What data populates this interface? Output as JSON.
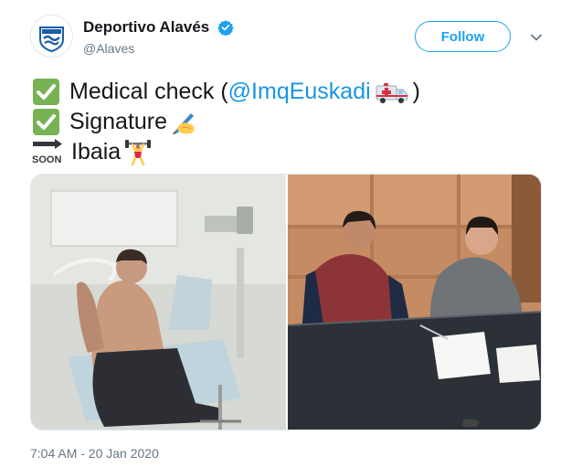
{
  "account": {
    "display_name": "Deportivo Alavés",
    "handle": "@Alaves",
    "avatar_icon": "deportivo-alaves-crest-icon",
    "verified_icon": "verified-badge-icon"
  },
  "actions": {
    "follow_label": "Follow",
    "more_icon": "chevron-down-icon"
  },
  "tweet": {
    "lines": [
      {
        "icon": "check-mark-button-icon",
        "before": "Medical check (",
        "mention": "@ImqEuskadi",
        "after_icon": "ambulance-icon",
        "after": ")"
      },
      {
        "icon": "check-mark-button-icon",
        "text": "Signature",
        "after_icon": "writing-hand-icon"
      },
      {
        "icon": "soon-arrow-icon",
        "icon_label": "SOON",
        "text": "Ibaia",
        "after_icon": "weight-lifter-icon"
      }
    ]
  },
  "media": {
    "photos": [
      {
        "subject": "player-medical-check-photo"
      },
      {
        "subject": "contract-signing-photo"
      }
    ]
  },
  "timestamp": "7:04 AM - 20 Jan 2020",
  "colors": {
    "link": "#1b95e0",
    "follow": "#1da1f2",
    "check_green": "#77b255",
    "muted": "#657786"
  }
}
